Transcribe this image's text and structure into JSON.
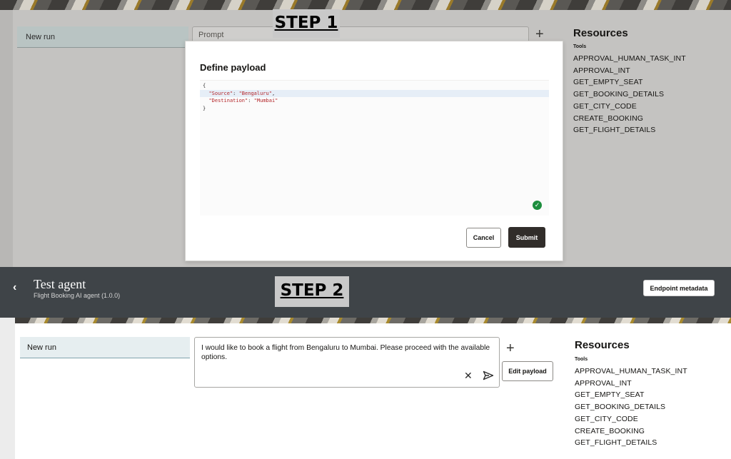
{
  "step1": {
    "label": "STEP 1",
    "run_item": "New run",
    "prompt_placeholder": "Prompt",
    "plus": "+",
    "resources": {
      "title": "Resources",
      "subtitle": "Tools",
      "tools": [
        "APPROVAL_HUMAN_TASK_INT",
        "APPROVAL_INT",
        "GET_EMPTY_SEAT",
        "GET_BOOKING_DETAILS",
        "GET_CITY_CODE",
        "CREATE_BOOKING",
        "GET_FLIGHT_DETAILS"
      ]
    },
    "modal": {
      "title": "Define payload",
      "payload_lines": [
        {
          "open": "{"
        },
        {
          "key": "\"Source\"",
          "sep": ": ",
          "value": "\"Bengaluru\"",
          "tail": ","
        },
        {
          "key": "\"Destination\"",
          "sep": ": ",
          "value": "\"Mumbai\"",
          "tail": ""
        },
        {
          "open": "}"
        }
      ],
      "cancel_label": "Cancel",
      "submit_label": "Submit"
    }
  },
  "step2": {
    "label": "STEP 2",
    "header": {
      "back": "‹",
      "title": "Test agent",
      "subtitle": "Flight Booking AI agent (1.0.0)",
      "endpoint_label": "Endpoint metadata"
    },
    "run_item": "New run",
    "prompt_text": "I would like to book a flight from Bengaluru to Mumbai. Please proceed with the available options.",
    "plus": "+",
    "edit_payload_label": "Edit payload",
    "clear_icon": "✕",
    "resources": {
      "title": "Resources",
      "subtitle": "Tools",
      "tools": [
        "APPROVAL_HUMAN_TASK_INT",
        "APPROVAL_INT",
        "GET_EMPTY_SEAT",
        "GET_BOOKING_DETAILS",
        "GET_CITY_CODE",
        "CREATE_BOOKING",
        "GET_FLIGHT_DETAILS"
      ]
    }
  },
  "icons": {
    "valid": "check-circle-icon",
    "send": "send-icon",
    "clear": "close-icon",
    "back": "chevron-left-icon",
    "add": "plus-icon"
  },
  "colors": {
    "dark_header": "#3f4448",
    "submit_bg": "#312d2a",
    "valid_green": "#1d8e3e",
    "json_string": "#b4262a"
  }
}
